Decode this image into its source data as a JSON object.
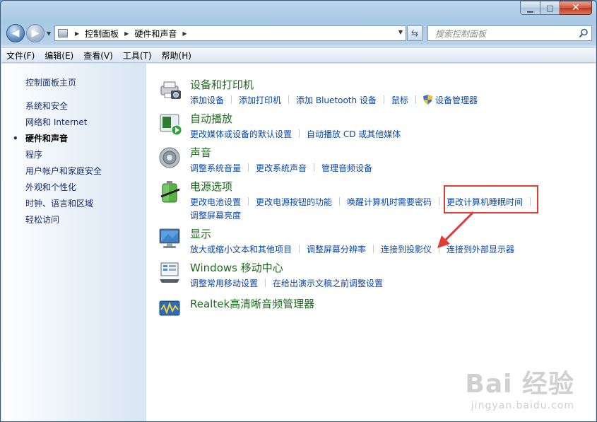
{
  "window": {
    "caption": {
      "minimize": "▁",
      "maximize": "□",
      "close": "✕"
    }
  },
  "nav": {
    "back_icon": "arrow-left-icon",
    "forward_icon": "arrow-right-icon",
    "breadcrumb": [
      "控制面板",
      "硬件和声音"
    ],
    "search_placeholder": "搜索控制面板"
  },
  "menu": [
    "文件(F)",
    "编辑(E)",
    "查看(V)",
    "工具(T)",
    "帮助(H)"
  ],
  "sidebar": {
    "home": "控制面板主页",
    "items": [
      "系统和安全",
      "网络和 Internet",
      "硬件和声音",
      "程序",
      "用户帐户和家庭安全",
      "外观和个性化",
      "时钟、语言和区域",
      "轻松访问"
    ],
    "active_index": 2
  },
  "categories": [
    {
      "title": "设备和打印机",
      "icon": "printer-camera-icon",
      "links": [
        [
          "添加设备",
          "添加打印机",
          "添加 Bluetooth 设备",
          "鼠标",
          "设备管理器"
        ]
      ]
    },
    {
      "title": "自动播放",
      "icon": "autoplay-icon",
      "links": [
        [
          "更改媒体或设备的默认设置",
          "自动播放 CD 或其他媒体"
        ]
      ]
    },
    {
      "title": "声音",
      "icon": "speaker-icon",
      "links": [
        [
          "调整系统音量",
          "更改系统声音",
          "管理音频设备"
        ]
      ]
    },
    {
      "title": "电源选项",
      "icon": "battery-icon",
      "links": [
        [
          "更改电池设置",
          "更改电源按钮的功能",
          "唤醒计算机时需要密码",
          "更改计算机睡眠时间"
        ],
        [
          "调整屏幕亮度"
        ]
      ]
    },
    {
      "title": "显示",
      "icon": "monitor-icon",
      "links": [
        [
          "放大或缩小文本和其他项目",
          "调整屏幕分辨率",
          "连接到投影仪",
          "连接到外部显示器"
        ]
      ]
    },
    {
      "title": "Windows 移动中心",
      "icon": "mobility-center-icon",
      "links": [
        [
          "调整常用移动设置",
          "在给出演示文稿之前调整设置"
        ]
      ]
    },
    {
      "title": "Realtek高清晰音频管理器",
      "icon": "realtek-audio-icon",
      "links": []
    }
  ],
  "watermark": {
    "top": "Bai 经验",
    "bottom": "jingyan.baidu.com"
  },
  "colors": {
    "title_green": "#1e6a1e",
    "link_blue": "#0a46a8",
    "highlight_red": "#e23b36"
  }
}
